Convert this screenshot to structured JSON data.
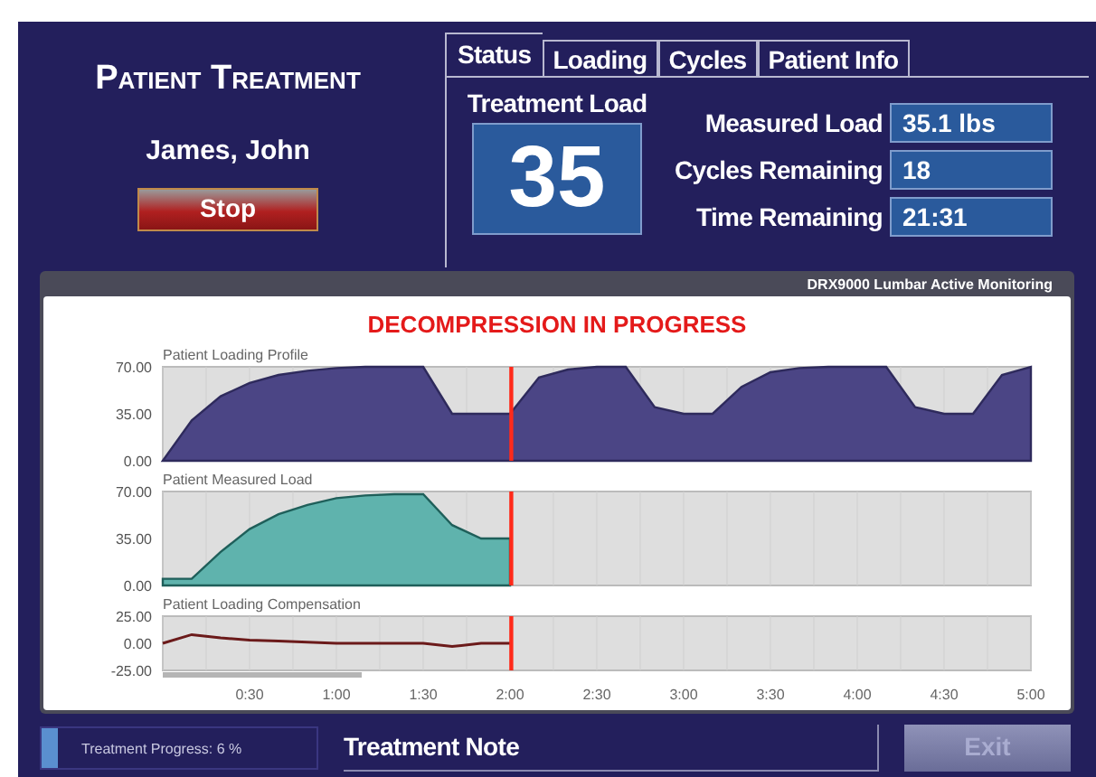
{
  "header": {
    "title": "Patient Treatment",
    "patient": "James, John",
    "stop_button": "Stop"
  },
  "tabs": [
    {
      "label": "Status",
      "selected": true
    },
    {
      "label": "Loading",
      "selected": false
    },
    {
      "label": "Cycles",
      "selected": false
    },
    {
      "label": "Patient Info",
      "selected": false
    }
  ],
  "treatment_load": {
    "label": "Treatment Load",
    "value": "35"
  },
  "readouts": [
    {
      "label": "Measured Load",
      "value": "35.1 lbs"
    },
    {
      "label": "Cycles Remaining",
      "value": "18"
    },
    {
      "label": "Time Remaining",
      "value": "21:31"
    }
  ],
  "monitor": {
    "title": "DRX9000 Lumbar Active Monitoring",
    "status": "DECOMPRESSION IN PROGRESS",
    "charts": [
      {
        "chart_data": {
          "type": "area",
          "title": "Patient Loading Profile",
          "grid": true,
          "x": [
            0,
            10,
            20,
            30,
            40,
            50,
            60,
            70,
            80,
            90,
            100,
            110,
            120,
            130,
            140,
            150,
            160,
            170,
            180,
            190,
            200,
            210,
            220,
            230,
            240,
            250,
            260,
            270,
            280,
            290,
            300
          ],
          "series": [
            {
              "color": "#4b4585",
              "values": [
                0,
                30,
                48,
                58,
                64,
                67,
                69,
                70,
                70,
                70,
                35,
                35,
                35,
                62,
                68,
                70,
                70,
                40,
                35,
                35,
                55,
                66,
                69,
                70,
                70,
                70,
                40,
                35,
                35,
                64,
                70
              ]
            }
          ],
          "xlim": [
            0,
            300
          ],
          "ylim": [
            0,
            70
          ],
          "yticks": [
            {
              "value": 0,
              "label": "0.00"
            },
            {
              "value": 35,
              "label": "35.00"
            },
            {
              "value": 70,
              "label": "70.00"
            }
          ],
          "ref_lines": [
            {
              "axis": "x",
              "value": 120,
              "color": "#ff2a1a"
            }
          ]
        }
      },
      {
        "chart_data": {
          "type": "area",
          "title": "Patient Measured Load",
          "grid": true,
          "x": [
            0,
            10,
            20,
            30,
            40,
            50,
            60,
            70,
            80,
            90,
            100,
            110,
            120
          ],
          "series": [
            {
              "color": "#5fb3ad",
              "values": [
                5,
                5,
                25,
                42,
                53,
                60,
                65,
                67,
                68,
                68,
                45,
                35,
                35
              ]
            }
          ],
          "xlim": [
            0,
            300
          ],
          "ylim": [
            0,
            70
          ],
          "yticks": [
            {
              "value": 0,
              "label": "0.00"
            },
            {
              "value": 35,
              "label": "35.00"
            },
            {
              "value": 70,
              "label": "70.00"
            }
          ],
          "ref_lines": [
            {
              "axis": "x",
              "value": 120,
              "color": "#ff2a1a"
            }
          ]
        }
      },
      {
        "chart_data": {
          "type": "line",
          "title": "Patient Loading Compensation",
          "grid": true,
          "x": [
            0,
            10,
            20,
            30,
            40,
            50,
            60,
            70,
            80,
            90,
            100,
            110,
            120
          ],
          "series": [
            {
              "color": "#6b1a1a",
              "values": [
                0,
                8,
                5,
                3,
                2,
                1,
                0,
                0,
                0,
                0,
                -3,
                0,
                0
              ]
            }
          ],
          "xlim": [
            0,
            300
          ],
          "ylim": [
            -25,
            25
          ],
          "yticks": [
            {
              "value": -25,
              "label": "-25.00"
            },
            {
              "value": 0,
              "label": "0.00"
            },
            {
              "value": 25,
              "label": "25.00"
            }
          ],
          "xticks": [
            {
              "value": 30,
              "label": "0:30"
            },
            {
              "value": 60,
              "label": "1:00"
            },
            {
              "value": 90,
              "label": "1:30"
            },
            {
              "value": 120,
              "label": "2:00"
            },
            {
              "value": 150,
              "label": "2:30"
            },
            {
              "value": 180,
              "label": "3:00"
            },
            {
              "value": 210,
              "label": "3:30"
            },
            {
              "value": 240,
              "label": "4:00"
            },
            {
              "value": 270,
              "label": "4:30"
            },
            {
              "value": 300,
              "label": "5:00"
            }
          ],
          "ref_lines": [
            {
              "axis": "x",
              "value": 120,
              "color": "#ff2a1a"
            }
          ]
        }
      }
    ]
  },
  "footer": {
    "progress": {
      "label": "Treatment Progress: 6 %",
      "level": 0.06
    },
    "note_label": "Treatment Note",
    "exit_button": {
      "label": "Exit",
      "disabled": true
    }
  }
}
